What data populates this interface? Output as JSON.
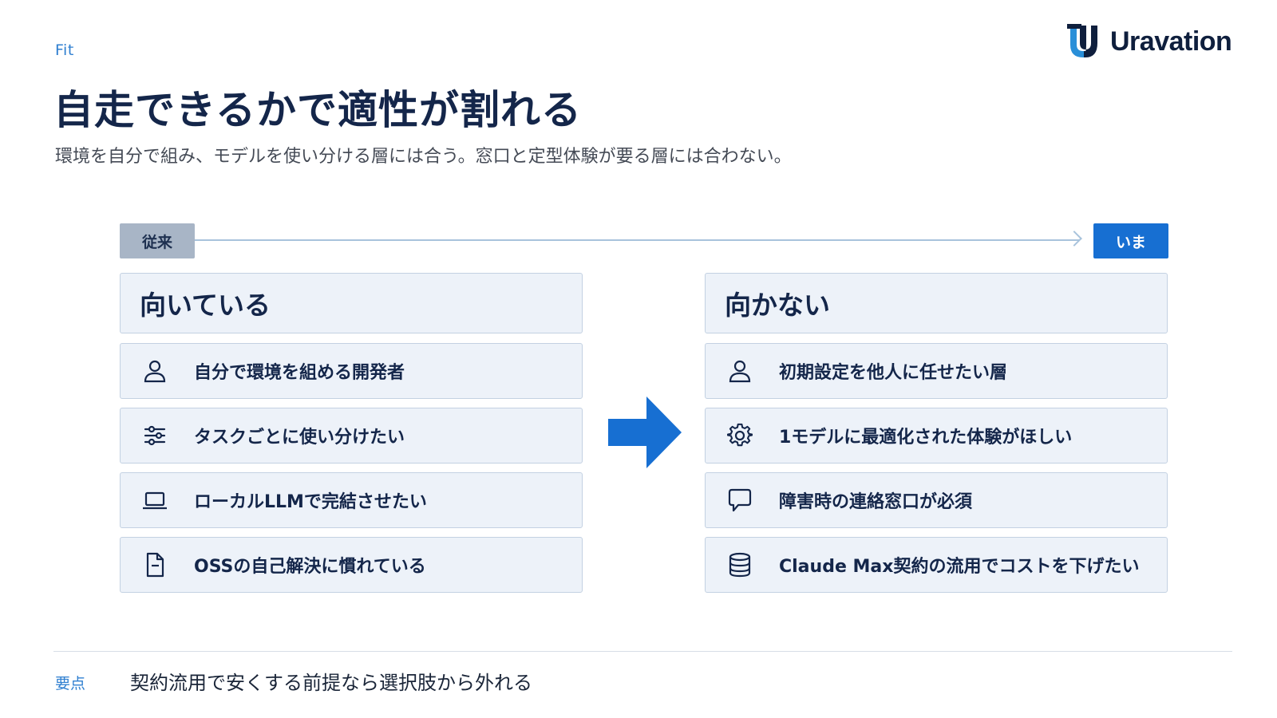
{
  "header": {
    "section_tag": "Fit",
    "brand": "Uravation",
    "title": "自走できるかで適性が割れる",
    "subtitle": "環境を自分で組み、モデルを使い分ける層には合う。窓口と定型体験が要る層には合わない。"
  },
  "timeline": {
    "from_label": "従来",
    "to_label": "いま"
  },
  "suited": {
    "heading": "向いている",
    "items": [
      {
        "icon": "person-icon",
        "label": "自分で環境を組める開発者"
      },
      {
        "icon": "sliders-icon",
        "label": "タスクごとに使い分けたい"
      },
      {
        "icon": "laptop-icon",
        "label": "ローカルLLMで完結させたい"
      },
      {
        "icon": "document-icon",
        "label": "OSSの自己解決に慣れている"
      }
    ]
  },
  "unsuited": {
    "heading": "向かない",
    "items": [
      {
        "icon": "person-icon",
        "label": "初期設定を他人に任せたい層"
      },
      {
        "icon": "gear-icon",
        "label": "1モデルに最適化された体験がほしい"
      },
      {
        "icon": "chat-bubble-icon",
        "label": "障害時の連絡窓口が必須"
      },
      {
        "icon": "database-icon",
        "label": "Claude Max契約の流用でコストを下げたい"
      }
    ]
  },
  "footer": {
    "key_label": "要点",
    "key_text": "契約流用で安くする前提なら選択肢から外れる"
  },
  "colors": {
    "accent": "#176fd2",
    "navy": "#14264a",
    "card_bg": "#edf2f9",
    "card_border": "#c3d1e2",
    "old_badge": "#a8b5c6"
  }
}
